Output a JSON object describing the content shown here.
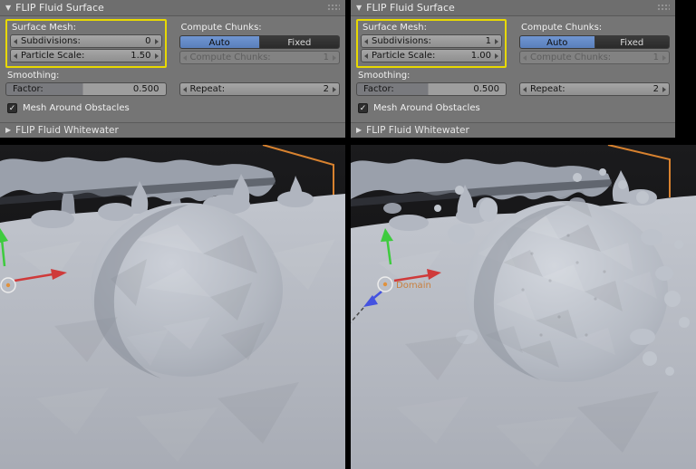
{
  "icons": {
    "expanded": "▼",
    "collapsed": "▶",
    "check": "✓"
  },
  "colors": {
    "accent_blue": "#5a7fbb",
    "highlight_yellow": "#e8d900",
    "domain_orange": "#d8822f",
    "axis_red": "#cf3a3a",
    "axis_green": "#3ecb3e",
    "axis_blue": "#4452e0"
  },
  "left": {
    "panel": {
      "header": "FLIP Fluid Surface",
      "surface_mesh_label": "Surface Mesh:",
      "subdivisions_label": "Subdivisions:",
      "subdivisions_value": "0",
      "particle_scale_label": "Particle Scale:",
      "particle_scale_value": "1.50",
      "compute_chunks_label": "Compute Chunks:",
      "auto_button": "Auto",
      "fixed_button": "Fixed",
      "compute_chunks_field_label": "Compute Chunks:",
      "compute_chunks_value": "1",
      "smoothing_label": "Smoothing:",
      "factor_label": "Factor:",
      "factor_value": "0.500",
      "repeat_label": "Repeat:",
      "repeat_value": "2",
      "mesh_around_obstacles_label": "Mesh Around Obstacles",
      "whitewater_header": "FLIP Fluid Whitewater"
    }
  },
  "right": {
    "panel": {
      "header": "FLIP Fluid Surface",
      "surface_mesh_label": "Surface Mesh:",
      "subdivisions_label": "Subdivisions:",
      "subdivisions_value": "1",
      "particle_scale_label": "Particle Scale:",
      "particle_scale_value": "1.00",
      "compute_chunks_label": "Compute Chunks:",
      "auto_button": "Auto",
      "fixed_button": "Fixed",
      "compute_chunks_field_label": "Compute Chunks:",
      "compute_chunks_value": "1",
      "smoothing_label": "Smoothing:",
      "factor_label": "Factor:",
      "factor_value": "0.500",
      "repeat_label": "Repeat:",
      "repeat_value": "2",
      "mesh_around_obstacles_label": "Mesh Around Obstacles",
      "whitewater_header": "FLIP Fluid Whitewater"
    },
    "viewport": {
      "domain_label": "Domain"
    }
  }
}
